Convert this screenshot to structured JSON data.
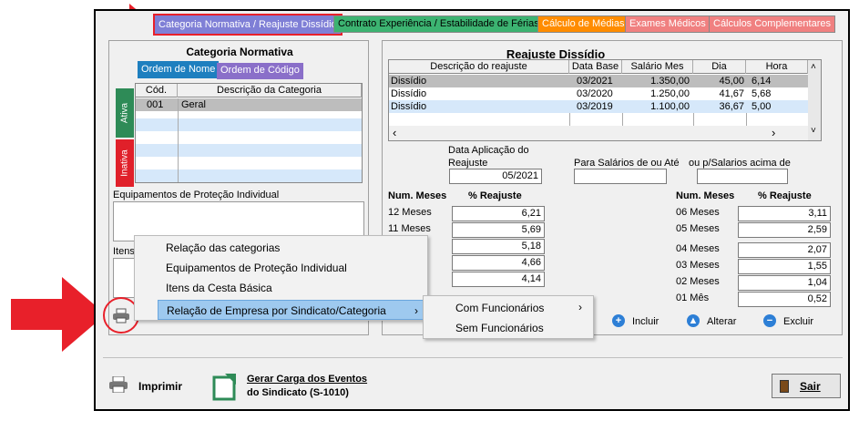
{
  "tabs": [
    {
      "label": "Categoria Normativa / Reajuste Dissídio",
      "bg": "#7f7fd6",
      "color": "#ffffff"
    },
    {
      "label": "Contrato Experiência / Estabilidade de Férias",
      "bg": "#3cb371",
      "color": "#000000"
    },
    {
      "label": "Cálculo de Médias",
      "bg": "#ff8c00",
      "color": "#ffffff"
    },
    {
      "label": "Exames Médicos",
      "bg": "#f08080",
      "color": "#ffffff"
    },
    {
      "label": "Cálculos Complementares",
      "bg": "#f08080",
      "color": "#ffffff"
    }
  ],
  "left": {
    "title": "Categoria Normativa",
    "order_tabs": [
      "Ordem de Nome",
      "Ordem de Código"
    ],
    "columns": [
      "Cód.",
      "Descrição da Categoria"
    ],
    "rows": [
      {
        "code": "001",
        "desc": "Geral"
      }
    ],
    "side_tabs": [
      "Ativa",
      "Inativa"
    ],
    "epi_label": "Equipamentos de Proteção Individual",
    "itens_label": "Itens"
  },
  "right": {
    "title": "Reajuste Dissídio",
    "columns": [
      "Descrição do reajuste",
      "Data Base",
      "Salário Mes",
      "Dia",
      "Hora"
    ],
    "rows": [
      {
        "desc": "Dissídio",
        "base": "03/2021",
        "salario": "1.350,00",
        "dia": "45,00",
        "hora": "6,14"
      },
      {
        "desc": "Dissídio",
        "base": "03/2020",
        "salario": "1.250,00",
        "dia": "41,67",
        "hora": "5,68"
      },
      {
        "desc": "Dissídio",
        "base": "03/2019",
        "salario": "1.100,00",
        "dia": "36,67",
        "hora": "5,00"
      }
    ],
    "data_aplic_label1": "Data Aplicação do",
    "data_aplic_label2": "Reajuste",
    "data_aplic_value": "05/2021",
    "para_salarios_label": "Para Salários de ou Até",
    "acima_label": "ou p/Salarios acima de",
    "num_meses_label": "Num. Meses",
    "pct_label": "% Reajuste",
    "left_months": [
      {
        "label": "12 Meses",
        "value": "6,21"
      },
      {
        "label": "11 Meses",
        "value": "5,69"
      },
      {
        "label": "",
        "value": "5,18"
      },
      {
        "label": "",
        "value": "4,66"
      },
      {
        "label": "",
        "value": "4,14"
      }
    ],
    "right_months": [
      {
        "label": "06 Meses",
        "value": "3,11"
      },
      {
        "label": "05 Meses",
        "value": "2,59"
      },
      {
        "label": "04 Meses",
        "value": "2,07"
      },
      {
        "label": "03 Meses",
        "value": "1,55"
      },
      {
        "label": "02 Meses",
        "value": "1,04"
      },
      {
        "label": "01 Mês",
        "value": "0,52"
      }
    ],
    "incluir": "Incluir",
    "alterar": "Alterar",
    "excluir": "Excluir"
  },
  "context_menu": {
    "items": [
      "Relação das categorias",
      "Equipamentos de Proteção Individual",
      "Itens da Cesta Básica",
      "Relação de Empresa por Sindicato/Categoria"
    ],
    "submenu": [
      "Com Funcionários",
      "Sem Funcionários"
    ]
  },
  "footer": {
    "imprimir": "Imprimir",
    "gerar1": "Gerar Carga dos Eventos",
    "gerar2": "do Sindicato (S-1010)",
    "sair": "Sair"
  }
}
